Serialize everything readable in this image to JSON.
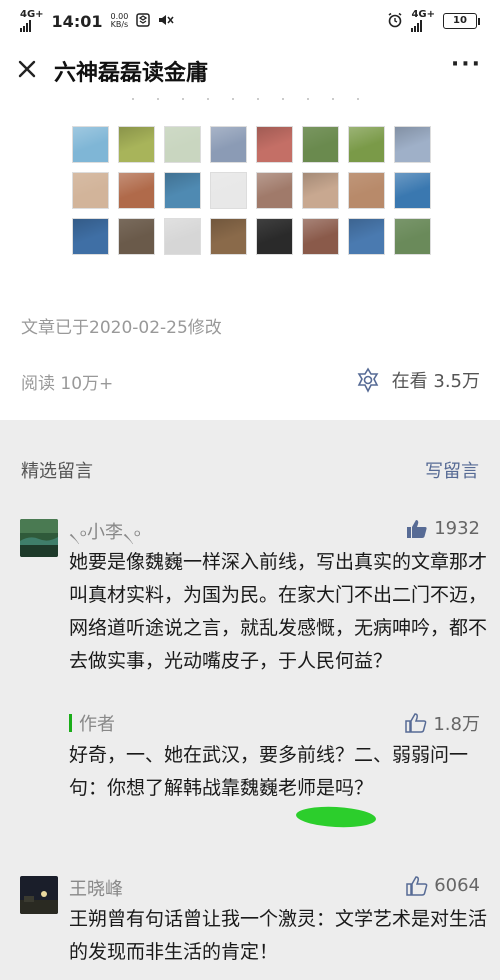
{
  "status_bar": {
    "network": "4G+",
    "time": "14:01",
    "speed_value": "0.00",
    "speed_unit": "KB/s",
    "network_right": "4G+",
    "battery": "10"
  },
  "header": {
    "title": "六神磊磊读金庸",
    "close_icon": "close-icon",
    "more_label": "···"
  },
  "thumbnail_colors": [
    "#7fb6d6",
    "#a8b45a",
    "#c9d6c0",
    "#8b9bb5",
    "#c46f66",
    "#6a8a4e",
    "#7a9a48",
    "#9fb0c8",
    "#d2b49a",
    "#b06a4a",
    "#4f8ab2",
    "#e8e8e8",
    "#a07a6a",
    "#c8a890",
    "#b88a6a",
    "#3a78b0",
    "#3f6fa5",
    "#6a5a4a",
    "#d6d6d6",
    "#8a6a4a",
    "#2a2a2a",
    "#8a5a4a",
    "#4a7ab0",
    "#6a8a5a"
  ],
  "article_meta": {
    "modified": "文章已于2020-02-25修改",
    "read_count": "阅读 10万+",
    "looking_label": "在看 3.5万"
  },
  "comments_section": {
    "title": "精选留言",
    "write_label": "写留言",
    "comments": [
      {
        "name": "৲৹小李৲৹",
        "likes": "1932",
        "text": "她要是像魏巍一样深入前线，写出真实的文章那才叫真材实料，为国为民。在家大门不出二门不迈，网络道听途说之言，就乱发感慨，无病呻吟，都不去做实事，光动嘴皮子，于人民何益？",
        "reply": {
          "label": "作者",
          "likes": "1.8万",
          "text": "好奇，一、她在武汉，要多前线？二、弱弱问一句：你想了解韩战靠魏巍老师是吗？"
        }
      },
      {
        "name": "王晓峰",
        "likes": "6064",
        "text": "王朔曾有句话曾让我一个激灵：文学艺术是对生活的发现而非生活的肯定！"
      }
    ]
  }
}
